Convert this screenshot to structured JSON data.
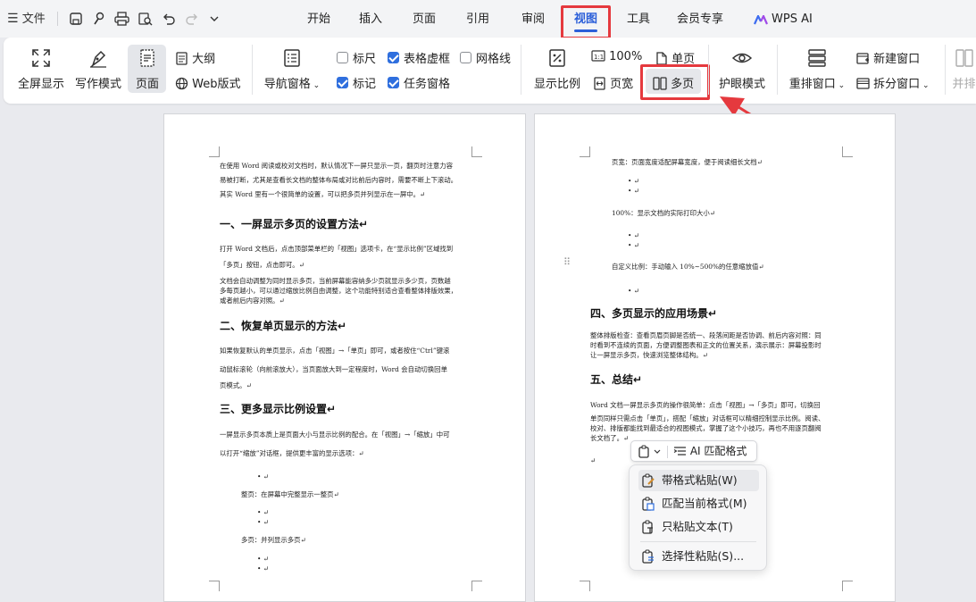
{
  "quickbar": {
    "menu_label": "文件"
  },
  "tabs": [
    "开始",
    "插入",
    "页面",
    "引用",
    "审阅",
    "视图",
    "工具",
    "会员专享",
    "WPS AI"
  ],
  "ribbon": {
    "fullscreen": "全屏显示",
    "write_mode": "写作模式",
    "page": "页面",
    "outline": "大纲",
    "web_layout": "Web版式",
    "nav_pane": "导航窗格",
    "ruler": "标尺",
    "table_gridlines": "表格虚框",
    "gridlines": "网格线",
    "mark": "标记",
    "task_pane": "任务窗格",
    "zoom_ratio": "显示比例",
    "zoom_100": "100%",
    "page_width": "页宽",
    "single_page": "单页",
    "multi_page": "多页",
    "eye_mode": "护眼模式",
    "arrange_window": "重排窗口",
    "new_window": "新建窗口",
    "split_window": "拆分窗口",
    "side_by_side": "并排"
  },
  "checks": {
    "ruler": false,
    "table_gridlines": true,
    "gridlines": false,
    "mark": true,
    "task_pane": true
  },
  "left_page": {
    "intro1": "在使用 Word 阅读或校对文档时，默认情况下一屏只显示一页，翻页时注意力容",
    "intro2": "易被打断，尤其是查看长文档的整体布局或对比前后内容时，需要不断上下滚动。",
    "intro3": "其实 Word 里有一个很简单的设置，可以把多页并列显示在一屏中。↵",
    "h1": "一、一屏显示多页的设置方法↵",
    "p1a": "打开 Word 文档后，点击顶部菜单栏的「视图」选项卡，在“显示比例”区域找到",
    "p1b": "「多页」按钮，点击即可。↵",
    "p2a": "文档会自动调整为同时显示多页，当前屏幕能容纳多少页就显示多少页，页数越",
    "p2b": "多每页越小，可以通过缩放比例自由调整，这个功能特别适合查看整体排版效果，",
    "p2c": "或者前后内容对照。↵",
    "h2": "二、恢复单页显示的方法↵",
    "p3a": "如果恢复默认的单页显示，点击「视图」→「单页」即可，或者按住“Ctrl”键滚",
    "p3b": "动鼠标滚轮（向前滚放大），当页面放大到一定程度时，Word 会自动切换回单",
    "p3c": "页模式。↵",
    "h3": "三、更多显示比例设置↵",
    "p4a": "一屏显示多页本质上是页面大小与显示比例的配合。在「视图」→「缩放」中可",
    "p4b": "以打开“缩放”对话框，提供更丰富的显示选项：↵",
    "b1": "• ↵",
    "l1": "整页：在屏幕中完整显示一整页↵",
    "b2": "• ↵",
    "b3": "• ↵",
    "l2": "多页：并列显示多页↵",
    "b4": "• ↵",
    "b5": "• ↵"
  },
  "right_page": {
    "r1": "页宽：页面宽度适配屏幕宽度，便于阅读细长文档↵",
    "rb1": "• ↵",
    "rb2": "• ↵",
    "r2": "100%：显示文档的实际打印大小↵",
    "rb3": "• ↵",
    "rb4": "• ↵",
    "r3": "自定义比例：手动输入 10%~500%的任意缩放值↵",
    "rb5": "• ↵",
    "h4": "四、多页显示的应用场景↵",
    "p5a": "整体排版检查：查看页眉页脚是否统一、段落间距是否协调、前后内容对照：同",
    "p5b": "时看到不连续的页面，方便调整图表和正文的位置关系，演示展示：屏幕投影时",
    "p5c": "让一屏显示多页，快速浏览整体结构。↵",
    "h5": "五、总结↵",
    "p6a": "Word 文档一屏显示多页的操作很简单：点击「视图」→「多页」即可，切换回",
    "p6b": "单页同样只需点击「单页」，搭配「缩放」对话框可以精细控制显示比例。阅读、",
    "p6c": "校对、排版都能找到最适合的视图模式，掌握了这个小技巧，再也不用逐页翻阅",
    "p6d": "长文档了。↵",
    "p6e": "↵"
  },
  "paste_bar": {
    "ai_match": "AI 匹配格式"
  },
  "paste_menu": {
    "keep_format": "带格式粘贴(W)",
    "match_format": "匹配当前格式(M)",
    "text_only": "只粘贴文本(T)",
    "selective": "选择性粘贴(S)..."
  },
  "colors": {
    "accent": "#2b5fd9",
    "highlight": "#e5393e",
    "checkbox": "#2f6fde"
  }
}
